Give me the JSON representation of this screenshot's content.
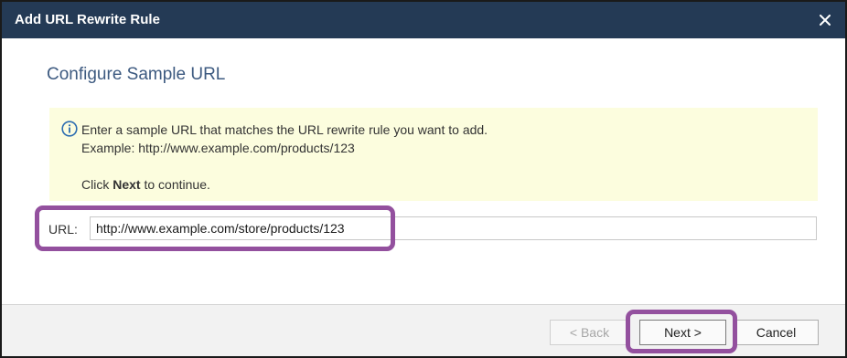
{
  "dialog": {
    "title": "Add URL Rewrite Rule",
    "close_icon": "close-icon"
  },
  "page": {
    "heading": "Configure Sample URL"
  },
  "info": {
    "icon": "info-icon",
    "line1": "Enter a sample URL that matches the URL rewrite rule you want to add.",
    "line2": "Example: http://www.example.com/products/123",
    "line3_prefix": "Click ",
    "line3_bold": "Next",
    "line3_suffix": " to continue."
  },
  "url": {
    "label": "URL:",
    "value": "http://www.example.com/store/products/123"
  },
  "buttons": {
    "back": "< Back",
    "next": "Next >",
    "cancel": "Cancel"
  },
  "colors": {
    "titlebar": "#243a55",
    "heading": "#3d5a80",
    "info_background": "#fcfdde",
    "highlight": "#93509e"
  }
}
